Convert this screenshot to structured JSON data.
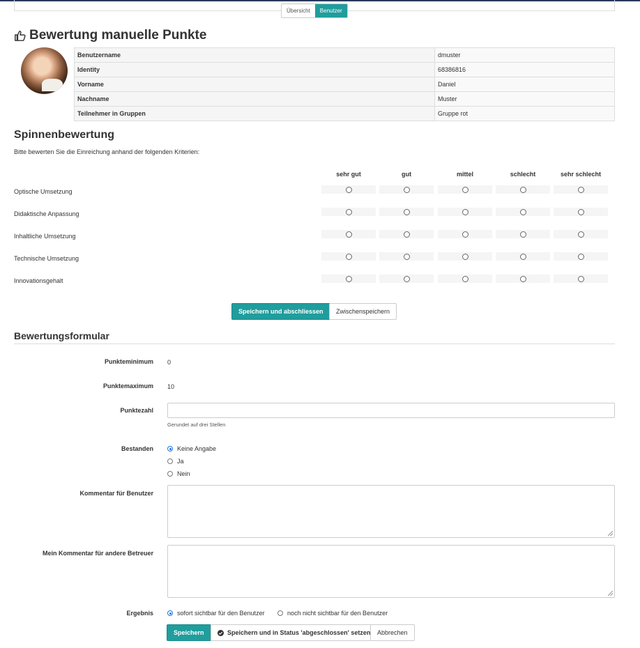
{
  "header": {
    "view_toggle": [
      {
        "label": "Übersicht",
        "active": false
      },
      {
        "label": "Benutzer",
        "active": true
      }
    ]
  },
  "page": {
    "title": "Bewertung manuelle Punkte",
    "title_icon": "thumbs-up-icon"
  },
  "user_info": {
    "rows": [
      {
        "label": "Benutzername",
        "value": "dmuster"
      },
      {
        "label": "Identity",
        "value": "68386816"
      },
      {
        "label": "Vorname",
        "value": "Daniel"
      },
      {
        "label": "Nachname",
        "value": "Muster"
      },
      {
        "label": "Teilnehmer in Gruppen",
        "value": "Gruppe rot"
      }
    ]
  },
  "rubric": {
    "title": "Spinnenbewertung",
    "intro": "Bitte bewerten Sie die Einreichung anhand der folgenden Kriterien:",
    "levels": [
      "sehr gut",
      "gut",
      "mittel",
      "schlecht",
      "sehr schlecht"
    ],
    "criteria": [
      "Optische Umsetzung",
      "Didaktische Anpassung",
      "Inhaltliche Umsetzung",
      "Technische Umsetzung",
      "Innovationsgehalt"
    ],
    "save_close_label": "Speichern und abschliessen",
    "interim_save_label": "Zwischenspeichern"
  },
  "form": {
    "title": "Bewertungsformular",
    "min_label": "Punkteminimum",
    "min_value": "0",
    "max_label": "Punktemaximum",
    "max_value": "10",
    "score_label": "Punktezahl",
    "score_value": "",
    "score_help": "Gerundet auf drei Stellen",
    "passed_label": "Bestanden",
    "passed_options": [
      {
        "label": "Keine Angabe",
        "selected": true
      },
      {
        "label": "Ja",
        "selected": false
      },
      {
        "label": "Nein",
        "selected": false
      }
    ],
    "user_comment_label": "Kommentar für Benutzer",
    "coach_comment_label": "Mein Kommentar für andere Betreuer",
    "result_label": "Ergebnis",
    "result_options": [
      {
        "label": "sofort sichtbar für den Benutzer",
        "selected": true
      },
      {
        "label": "noch nicht sichtbar für den Benutzer",
        "selected": false
      }
    ],
    "save_label": "Speichern",
    "save_done_label": "Speichern und in Status 'abgeschlossen' setzen",
    "cancel_label": "Abbrechen"
  },
  "colors": {
    "accent": "#209d9d",
    "radio_selected": "#1a73e8"
  }
}
